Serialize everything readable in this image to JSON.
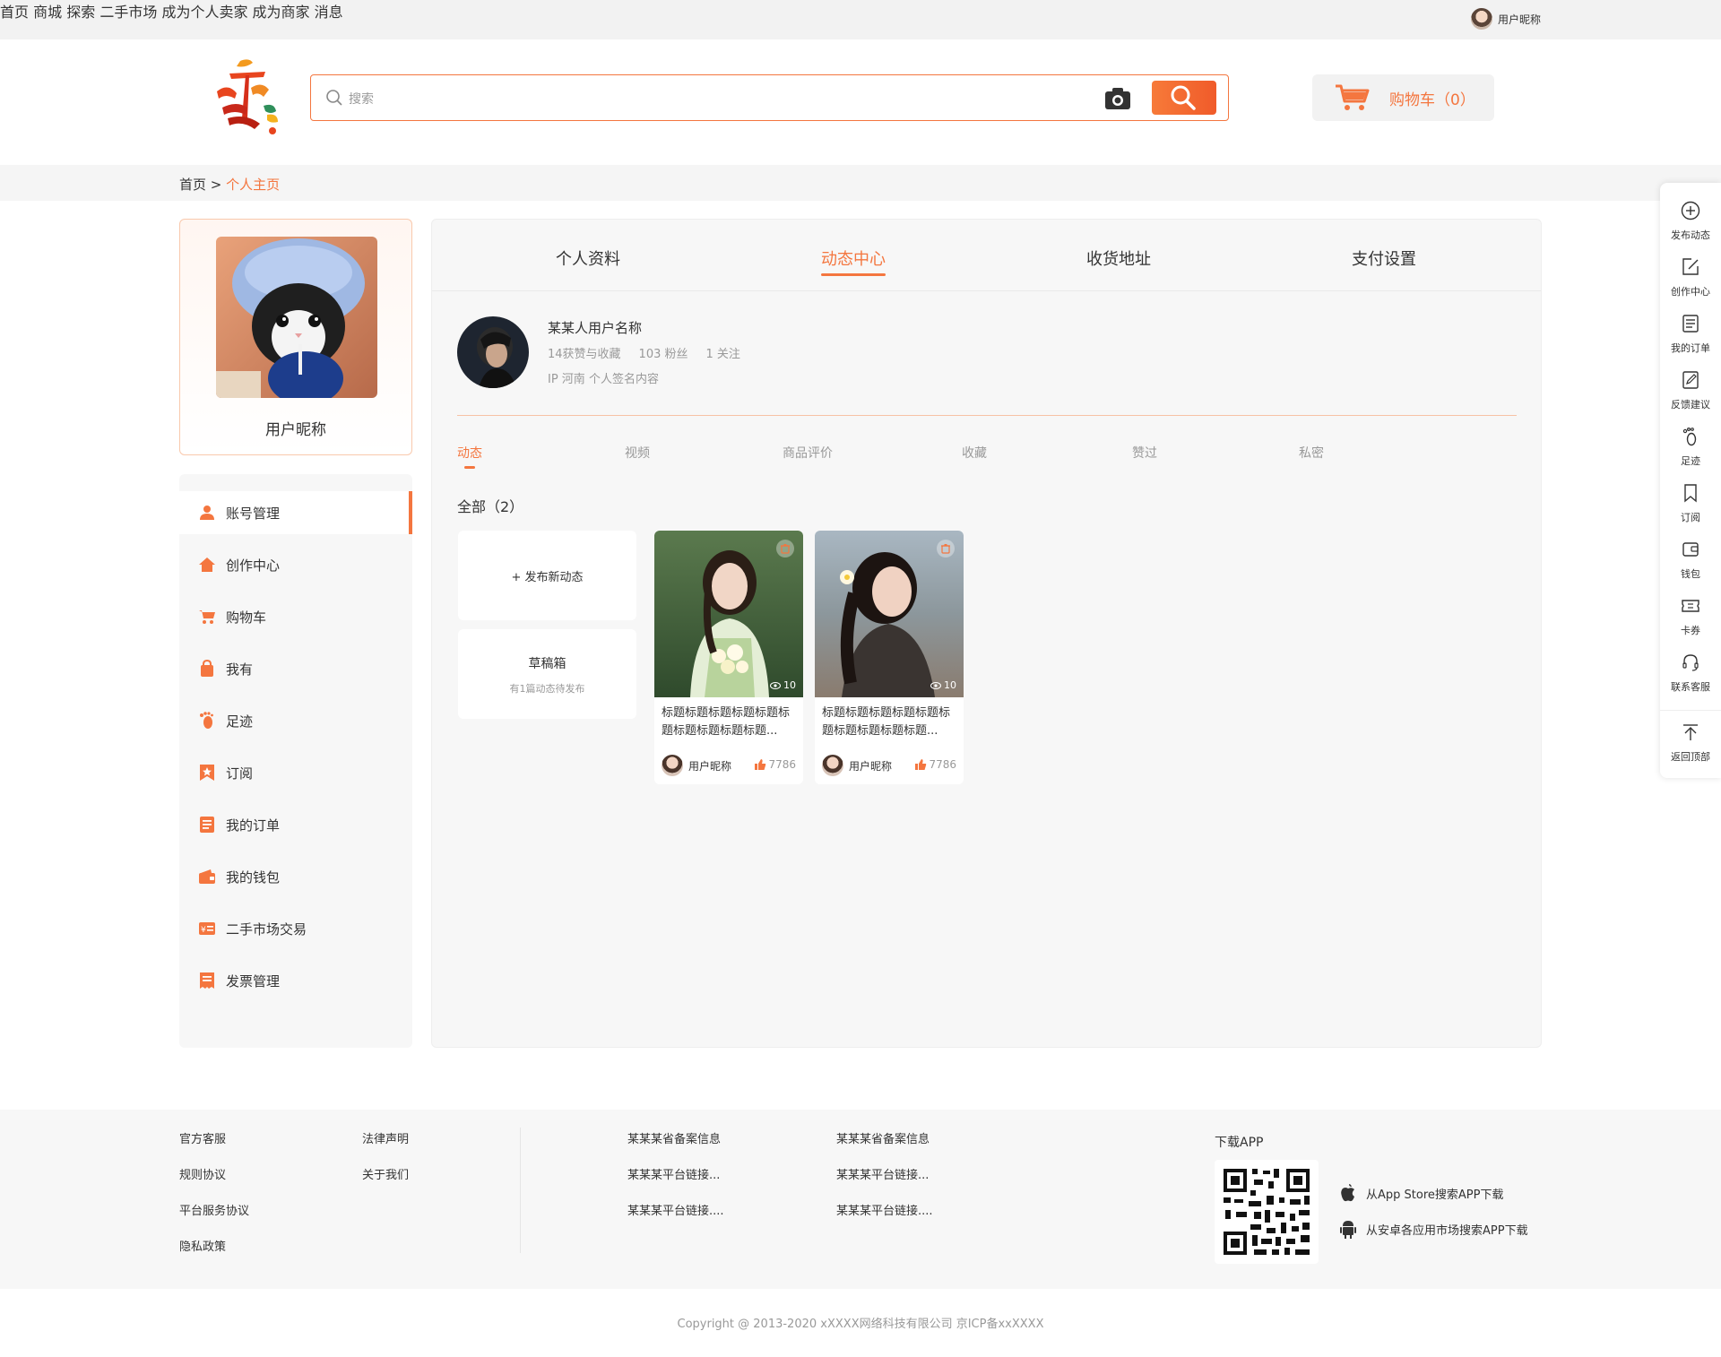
{
  "topnav": {
    "items": [
      "首页",
      "商城",
      "探索",
      "二手市场",
      "成为个人卖家",
      "成为商家",
      "消息"
    ],
    "user_name": "用户昵称"
  },
  "search": {
    "placeholder": "搜索"
  },
  "cart": {
    "label": "购物车（0）"
  },
  "breadcrumb": {
    "home": "首页",
    "sep": " > ",
    "current": "个人主页"
  },
  "profile": {
    "nickname": "用户昵称"
  },
  "sidebar": {
    "items": [
      {
        "label": "账号管理",
        "icon": "user-icon"
      },
      {
        "label": "创作中心",
        "icon": "home-icon"
      },
      {
        "label": "购物车",
        "icon": "cart-icon"
      },
      {
        "label": "我有",
        "icon": "bag-icon"
      },
      {
        "label": "足迹",
        "icon": "footprint-icon"
      },
      {
        "label": "订阅",
        "icon": "subscribe-icon"
      },
      {
        "label": "我的订单",
        "icon": "order-icon"
      },
      {
        "label": "我的钱包",
        "icon": "wallet-icon"
      },
      {
        "label": "二手市场交易",
        "icon": "trade-icon"
      },
      {
        "label": "发票管理",
        "icon": "invoice-icon"
      }
    ]
  },
  "tabs": [
    "个人资料",
    "动态中心",
    "收货地址",
    "支付设置"
  ],
  "user": {
    "name": "某某人用户名称",
    "likes": "14获赞与收藏",
    "fans": "103 粉丝",
    "follows": "1 关注",
    "signature": "IP 河南 个人签名内容"
  },
  "subtabs": [
    "动态",
    "视频",
    "商品评价",
    "收藏",
    "赞过",
    "私密"
  ],
  "all_label": "全部（2）",
  "new_post": "+ 发布新动态",
  "drafts": {
    "title": "草稿箱",
    "sub": "有1篇动态待发布"
  },
  "posts": [
    {
      "views": "10",
      "title": "标题标题标题标题标题标题标题标题标题标题...",
      "author": "用户昵称",
      "likes": "7786"
    },
    {
      "views": "10",
      "title": "标题标题标题标题标题标题标题标题标题标题...",
      "author": "用户昵称",
      "likes": "7786"
    }
  ],
  "floatbar": [
    {
      "label": "发布动态",
      "icon": "plus-circle-icon"
    },
    {
      "label": "创作中心",
      "icon": "edit-icon"
    },
    {
      "label": "我的订单",
      "icon": "list-icon"
    },
    {
      "label": "反馈建议",
      "icon": "feedback-icon"
    },
    {
      "label": "足迹",
      "icon": "footprint-icon"
    },
    {
      "label": "订阅",
      "icon": "bookmark-icon"
    },
    {
      "label": "钱包",
      "icon": "wallet-icon"
    },
    {
      "label": "卡券",
      "icon": "ticket-icon"
    },
    {
      "label": "联系客服",
      "icon": "headset-icon"
    },
    {
      "label": "返回顶部",
      "icon": "top-icon"
    }
  ],
  "footer": {
    "col1": [
      "官方客服",
      "规则协议",
      "平台服务协议",
      "隐私政策"
    ],
    "col2": [
      "法律声明",
      "关于我们"
    ],
    "col3": [
      "某某某省备案信息",
      "某某某平台链接...",
      "某某某平台链接...."
    ],
    "col4": [
      "某某某省备案信息",
      "某某某平台链接...",
      "某某某平台链接...."
    ],
    "download_title": "下载APP",
    "appstore": "从App Store搜索APP下载",
    "android": "从安卓各应用市场搜索APP下载",
    "copyright": "Copyright @ 2013-2020 xXXXX网络科技有限公司 京ICP备xxXXXX"
  },
  "colors": {
    "accent": "#f4763f",
    "bg_light": "#f7f7f7"
  }
}
